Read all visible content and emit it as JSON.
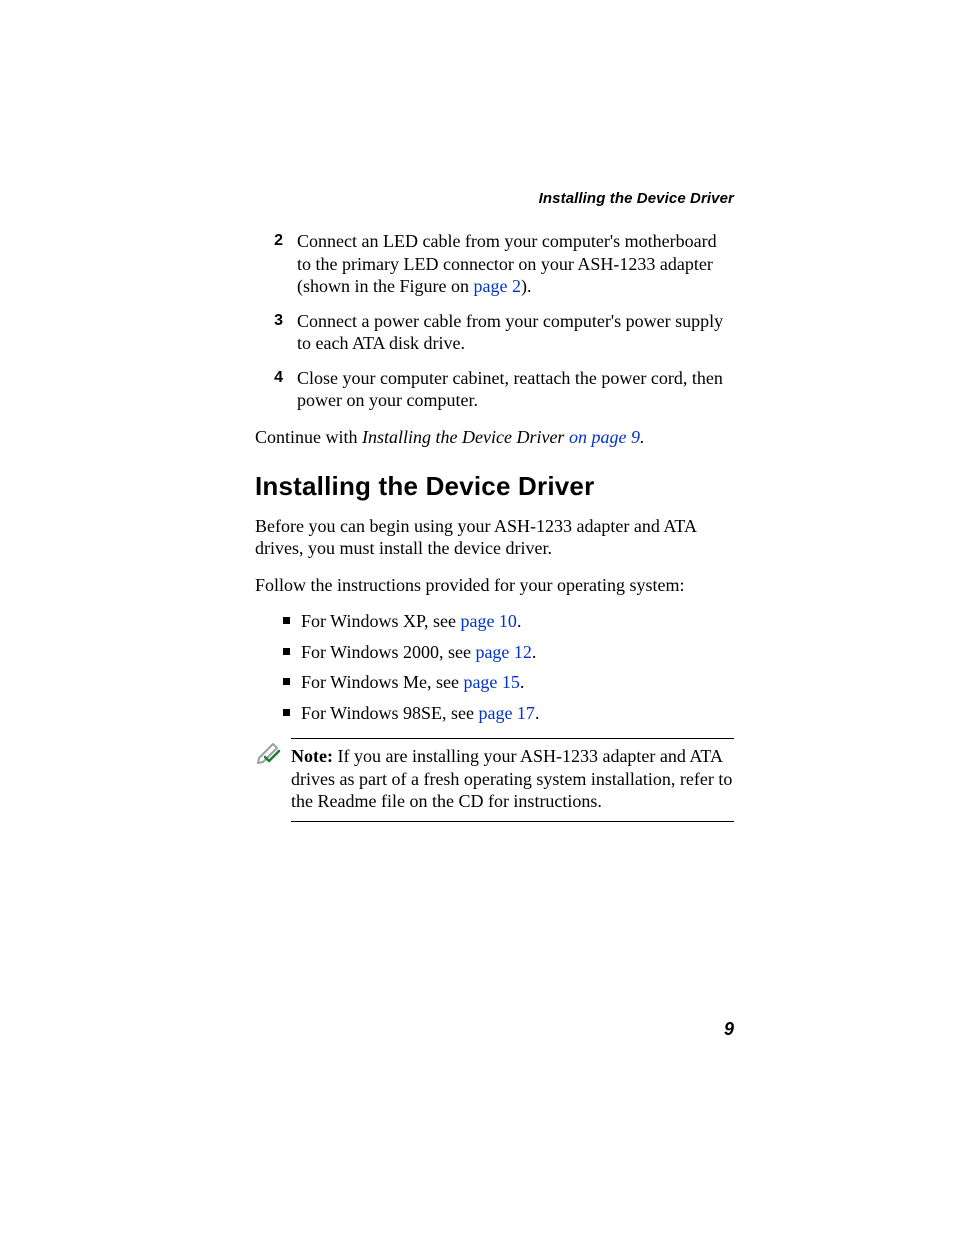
{
  "runningHeader": "Installing the Device Driver",
  "steps": [
    {
      "num": "2",
      "pre": "Connect an LED cable from your computer's motherboard to the primary LED connector on your ASH-1233 adapter (shown in the Figure on ",
      "link": "page 2",
      "post": ")."
    },
    {
      "num": "3",
      "pre": "Connect a power cable from your computer's power supply to each ATA disk drive.",
      "link": "",
      "post": ""
    },
    {
      "num": "4",
      "pre": "Close your computer cabinet, reattach the power cord, then power on your computer.",
      "link": "",
      "post": ""
    }
  ],
  "continue": {
    "pre": "Continue with ",
    "italicLead": "Installing the Device Driver ",
    "link": "on page 9",
    "post": "."
  },
  "heading": "Installing the Device Driver",
  "intro": "Before you can begin using your ASH-1233 adapter and ATA drives, you must install the device driver.",
  "follow": "Follow the instructions provided for your operating system:",
  "bullets": [
    {
      "pre": "For Windows XP, see ",
      "link": "page 10",
      "post": "."
    },
    {
      "pre": "For Windows 2000, see ",
      "link": "page 12",
      "post": "."
    },
    {
      "pre": "For Windows Me, see ",
      "link": "page 15",
      "post": "."
    },
    {
      "pre": "For Windows 98SE, see ",
      "link": "page 17",
      "post": "."
    }
  ],
  "note": {
    "label": "Note:",
    "text": " If you are installing your ASH-1233 adapter and ATA drives as part of a fresh operating system installation, refer to the Readme file on the CD for instructions."
  },
  "pageNumber": "9"
}
